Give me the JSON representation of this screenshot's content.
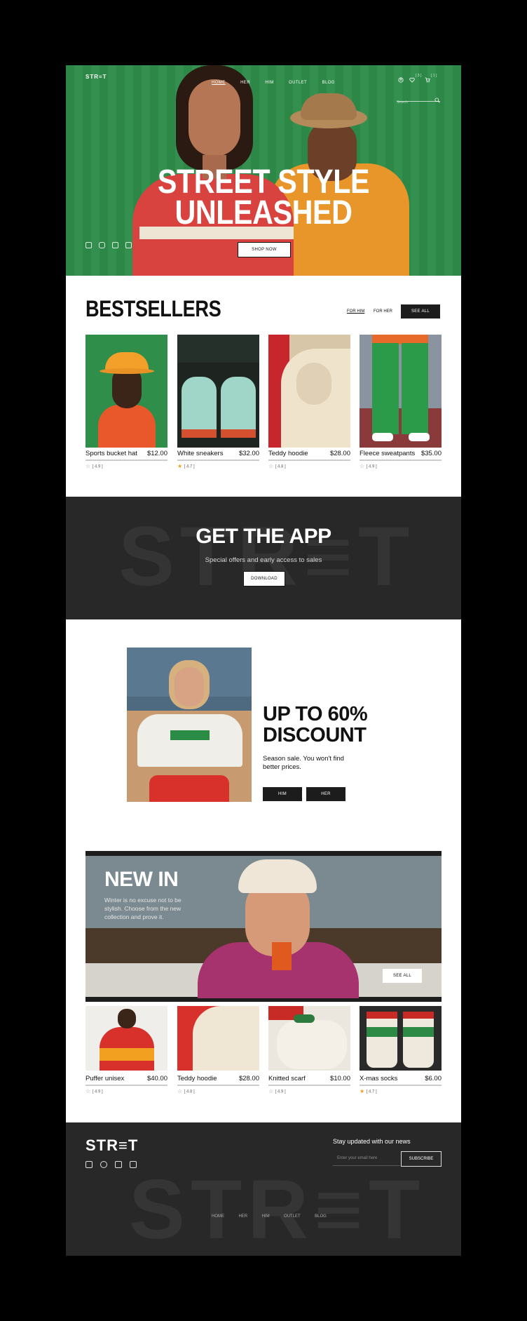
{
  "brand": "STR≡T",
  "nav": [
    "HOME",
    "HER",
    "HIM",
    "OUTLET",
    "BLOG"
  ],
  "header_icons": {
    "wishlist_count": "[ 3 ]",
    "cart_count": "[ 1 ]",
    "search_placeholder": "Search"
  },
  "hero": {
    "title_line1": "STREET STYLE",
    "title_line2": "UNLEASHED",
    "cta": "SHOP NOW",
    "bg": "#2f8e4a"
  },
  "bestsellers": {
    "title": "BESTSELLERS",
    "filter_him": "FOR HIM",
    "filter_her": "FOR HER",
    "see_all": "SEE ALL",
    "products": [
      {
        "name": "Sports bucket hat",
        "price": "$12.00",
        "rating": "[ 4.9 ]",
        "starred": false
      },
      {
        "name": "White sneakers",
        "price": "$32.00",
        "rating": "[ 4.7 ]",
        "starred": true
      },
      {
        "name": "Teddy hoodie",
        "price": "$28.00",
        "rating": "[ 4.8 ]",
        "starred": false
      },
      {
        "name": "Fleece sweatpants",
        "price": "$35.00",
        "rating": "[ 4.9 ]",
        "starred": false
      }
    ]
  },
  "app": {
    "watermark": "STR≡T",
    "title": "GET THE APP",
    "subtitle": "Special offers and early access to sales",
    "cta": "DOWNLOAD"
  },
  "discount": {
    "title_line1": "UP TO 60%",
    "title_line2": "DISCOUNT",
    "text": "Season sale. You won't find better prices.",
    "btn_him": "HIM",
    "btn_her": "HER"
  },
  "new_in": {
    "title": "NEW IN",
    "text": "Winter is no excuse not to be stylish. Choose from the new collection and prove it.",
    "see_all": "SEE ALL",
    "products": [
      {
        "name": "Puffer unisex",
        "price": "$40.00",
        "rating": "[ 4.9 ]",
        "starred": false
      },
      {
        "name": "Teddy hoodie",
        "price": "$28.00",
        "rating": "[ 4.8 ]",
        "starred": false
      },
      {
        "name": "Knitted scarf",
        "price": "$10.00",
        "rating": "[ 4.9 ]",
        "starred": false
      },
      {
        "name": "X-mas socks",
        "price": "$6.00",
        "rating": "[ 4.7 ]",
        "starred": true
      }
    ]
  },
  "footer": {
    "logo": "STR≡T",
    "newsletter_title": "Stay updated with our news",
    "email_placeholder": "Enter your email here",
    "subscribe": "SUBSCRIBE",
    "watermark": "STR≡T",
    "nav": [
      "HOME",
      "HER",
      "HIM",
      "OUTLET",
      "BLOG"
    ]
  },
  "colors": {
    "accent_green": "#2f8e4a",
    "dark": "#282828",
    "star": "#f0a020"
  }
}
